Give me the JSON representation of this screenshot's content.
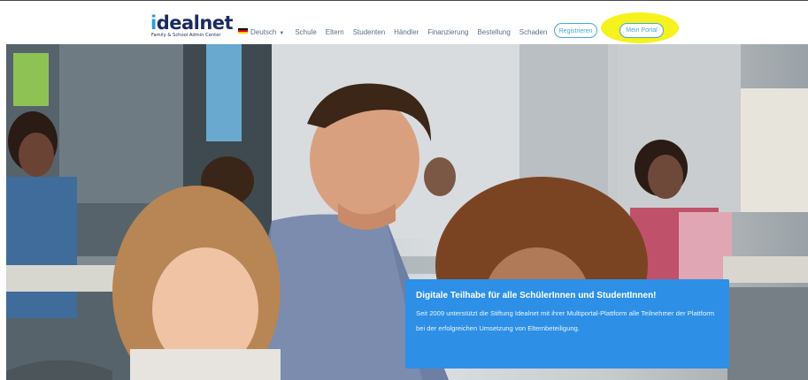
{
  "logo": {
    "name_prefix": "i",
    "name_rest": "dealnet",
    "subtitle": "Family & School Admin Center"
  },
  "nav": {
    "language": "Deutsch",
    "items": [
      "Schule",
      "Eltern",
      "Studenten",
      "Händler",
      "Finanzierung",
      "Bestellung",
      "Schaden"
    ]
  },
  "buttons": {
    "register": "Registrieren",
    "portal": "Mein Portal"
  },
  "colors": {
    "brand_dark": "#1b2b5e",
    "accent": "#47a8d8",
    "promo_bg": "#2d8fe6",
    "highlight": "#f6f21e"
  },
  "hero": {
    "promo_title": "Digitale Teilhabe für alle SchülerInnen und StudentInnen!",
    "promo_text": "Seit 2009 unterstützt die Stiftung Idealnet mit ihrer Multiportal-Plattform alle Teilnehmer der Plattform bei der erfolgreichen Umsetzung von Elternbeteiligung."
  }
}
